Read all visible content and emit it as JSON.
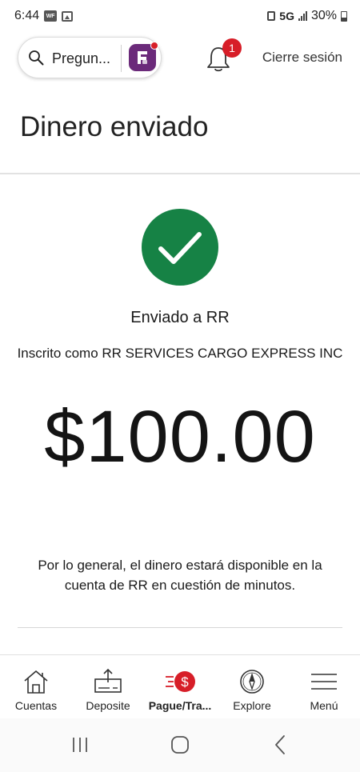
{
  "status_bar": {
    "time": "6:44",
    "notification_badge": "WF",
    "network": "5G",
    "battery": "30%"
  },
  "header": {
    "search_placeholder": "Pregun...",
    "notification_count": "1",
    "sign_out_label": "Cierre sesión"
  },
  "page": {
    "title": "Dinero enviado"
  },
  "confirmation": {
    "sent_to": "Enviado a RR",
    "enrolled_as": "Inscrito como RR SERVICES CARGO EXPRESS INC",
    "amount": "$100.00",
    "availability_note": "Por lo general, el dinero estará disponible en la cuenta de RR en cuestión de minutos."
  },
  "bottom_nav": {
    "items": [
      {
        "label": "Cuentas",
        "icon": "home-icon",
        "active": false
      },
      {
        "label": "Deposite",
        "icon": "deposit-icon",
        "active": false
      },
      {
        "label": "Pague/Tra...",
        "icon": "pay-transfer-icon",
        "active": true
      },
      {
        "label": "Explore",
        "icon": "compass-icon",
        "active": false
      },
      {
        "label": "Menú",
        "icon": "hamburger-menu-icon",
        "active": false
      }
    ]
  },
  "colors": {
    "brand_red": "#d71e28",
    "success_green": "#168245",
    "brand_purple": "#6b2a7a"
  }
}
